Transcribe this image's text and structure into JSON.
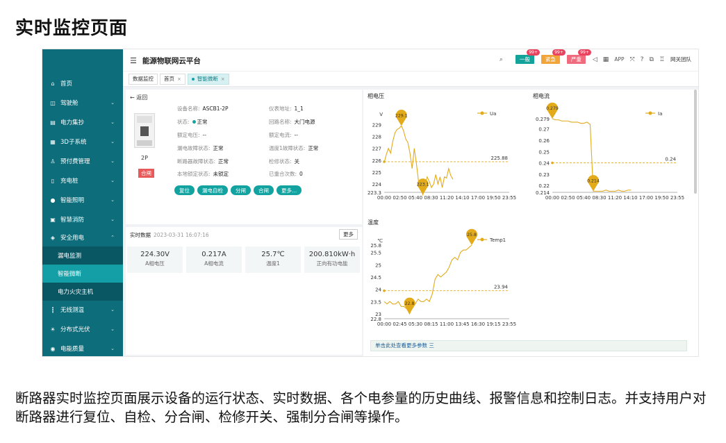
{
  "slide": {
    "title": "实时监控页面",
    "caption": "断路器实时监控页面展示设备的运行状态、实时数据、各个电参量的历史曲线、报警信息和控制日志。并支持用户对断路器进行复位、自检、分合闸、检修开关、强制分合闸等操作。"
  },
  "app": {
    "title": "能源物联网云平台",
    "menu_icon": "menu-icon",
    "alerts": [
      {
        "label": "一般",
        "count": "99+",
        "color": "#14a39b"
      },
      {
        "label": "紧急",
        "count": "99+",
        "color": "#f0a43a"
      },
      {
        "label": "严重",
        "count": "99+",
        "color": "#f06b7e"
      }
    ],
    "app_label": "APP",
    "user": "网关团队"
  },
  "sidebar": {
    "items": [
      {
        "label": "首页",
        "icon": "home-icon"
      },
      {
        "label": "驾驶舱",
        "icon": "dashboard-icon"
      },
      {
        "label": "电力集抄",
        "icon": "meter-icon"
      },
      {
        "label": "3D子系统",
        "icon": "cube-icon"
      },
      {
        "label": "预付费管理",
        "icon": "user-icon"
      },
      {
        "label": "充电桩",
        "icon": "charger-icon"
      },
      {
        "label": "智能照明",
        "icon": "bulb-icon"
      },
      {
        "label": "智慧消防",
        "icon": "fire-icon"
      },
      {
        "label": "安全用电",
        "icon": "shield-icon"
      },
      {
        "label": "无线测温",
        "icon": "thermometer-icon"
      },
      {
        "label": "分布式光伏",
        "icon": "sun-icon"
      },
      {
        "label": "电能质量",
        "icon": "quality-icon"
      }
    ],
    "sub": [
      "漏电监测",
      "智能微断",
      "电力火灾主机"
    ]
  },
  "tabs": [
    "数据监控",
    "首页",
    "智能微断"
  ],
  "device": {
    "back": "返回",
    "model_label": "2P",
    "state_tag": "合闸",
    "fields": {
      "name_k": "设备名称:",
      "name_v": "ASCB1-2P",
      "addr_k": "仪表地址:",
      "addr_v": "1_1",
      "status_k": "状态:",
      "status_v": "正常",
      "loop_k": "回路名称:",
      "loop_v": "大门电源",
      "rv_k": "额定电压:",
      "rv_v": "--",
      "rc_k": "额定电流:",
      "rc_v": "--",
      "leak_k": "漏电故障状态:",
      "leak_v": "正常",
      "temp_k": "温度1故障状态:",
      "temp_v": "正常",
      "brk_k": "断路器故障状态:",
      "brk_v": "正常",
      "maint_k": "检修状态:",
      "maint_v": "关",
      "lock_k": "本地锁定状态:",
      "lock_v": "未锁定",
      "reclose_k": "已重合次数:",
      "reclose_v": "0"
    },
    "buttons": [
      "复位",
      "漏电自检",
      "分闸",
      "合闸",
      "更多..."
    ]
  },
  "realtime": {
    "title": "实时数据",
    "time": "2023-03-31 16:07:16",
    "more": "更多",
    "cards": [
      {
        "value": "224.30V",
        "label": "A相电压"
      },
      {
        "value": "0.217A",
        "label": "A相电流"
      },
      {
        "value": "25.7℃",
        "label": "温度1"
      },
      {
        "value": "200.810kW·h",
        "label": "正向有功电能"
      }
    ]
  },
  "charts": {
    "voltage_title": "相电压",
    "current_title": "相电流",
    "temp_title": "温度",
    "more_link": "单击此处查看更多参数 三"
  },
  "chart_data": [
    {
      "type": "line",
      "title": "相电压",
      "ylabel": "V",
      "series": [
        {
          "name": "Ua",
          "color": "#e3ab1a"
        }
      ],
      "x_ticks": [
        "00:00",
        "02:50",
        "05:40",
        "08:30",
        "11:20",
        "14:10",
        "17:00",
        "19:50",
        "23:55"
      ],
      "y_ticks": [
        "229",
        "228",
        "227",
        "226",
        "225",
        "224",
        "223.3"
      ],
      "ylim": [
        223.3,
        229.5
      ],
      "values": [
        225.8,
        226.5,
        227.0,
        226.6,
        227.6,
        228.3,
        228.6,
        228.7,
        228.9,
        228.5,
        227.8,
        227.5,
        226.6,
        225.3,
        227.0,
        225.7,
        224.2,
        223.6,
        223.1,
        223.9,
        224.6,
        224.2,
        223.7,
        224.0,
        224.8,
        224.0,
        224.6,
        223.7,
        224.6,
        224.5,
        225.3,
        224.7,
        224.4
      ],
      "points_span": [
        0.0,
        0.55
      ],
      "max_label": "229.1",
      "min_label": "223.1",
      "avg_label": "225.88"
    },
    {
      "type": "line",
      "title": "相电流",
      "series": [
        {
          "name": "Ia",
          "color": "#e3ab1a"
        }
      ],
      "x_ticks": [
        "00:00",
        "02:50",
        "05:40",
        "08:30",
        "11:20",
        "14:10",
        "17:00",
        "19:50",
        "23:55"
      ],
      "y_ticks": [
        "0.279",
        "0.27",
        "0.26",
        "0.25",
        "0.24",
        "0.23",
        "0.22",
        "0.214"
      ],
      "ylim": [
        0.214,
        0.279
      ],
      "values": [
        0.279,
        0.278,
        0.278,
        0.277,
        0.277,
        0.277,
        0.276,
        0.276,
        0.276,
        0.275,
        0.275,
        0.276,
        0.274,
        0.215,
        0.215,
        0.215,
        0.215,
        0.216,
        0.215,
        0.215,
        0.215,
        0.216,
        0.215,
        0.215,
        0.216,
        0.216
      ],
      "points_span": [
        0.0,
        0.63
      ],
      "max_label": "0.279",
      "min_label": "0.214",
      "avg_label": "0.24"
    },
    {
      "type": "line",
      "title": "温度",
      "ylabel": "℃",
      "series": [
        {
          "name": "Temp1",
          "color": "#e3ab1a"
        }
      ],
      "x_ticks": [
        "00:00",
        "02:45",
        "05:30",
        "08:15",
        "11:00",
        "13:45",
        "16:30",
        "19:15",
        "23:55"
      ],
      "y_ticks": [
        "25.8",
        "25.5",
        "25",
        "24.5",
        "24",
        "23.5",
        "23",
        "22.8"
      ],
      "ylim": [
        22.8,
        25.8
      ],
      "values": [
        23.5,
        23.4,
        23.5,
        23.4,
        23.4,
        23.5,
        23.3,
        23.3,
        23.2,
        23.0,
        23.3,
        23.4,
        23.6,
        23.5,
        23.5,
        23.6,
        23.5,
        23.8,
        24.4,
        24.6,
        24.5,
        24.6,
        24.7,
        24.9,
        25.2,
        25.3,
        25.2,
        25.5,
        25.6,
        25.6,
        25.7,
        25.8
      ],
      "points_span": [
        0.0,
        0.7
      ],
      "max_label": "25.8",
      "min_label": "22.8",
      "avg_label": "23.94"
    }
  ]
}
